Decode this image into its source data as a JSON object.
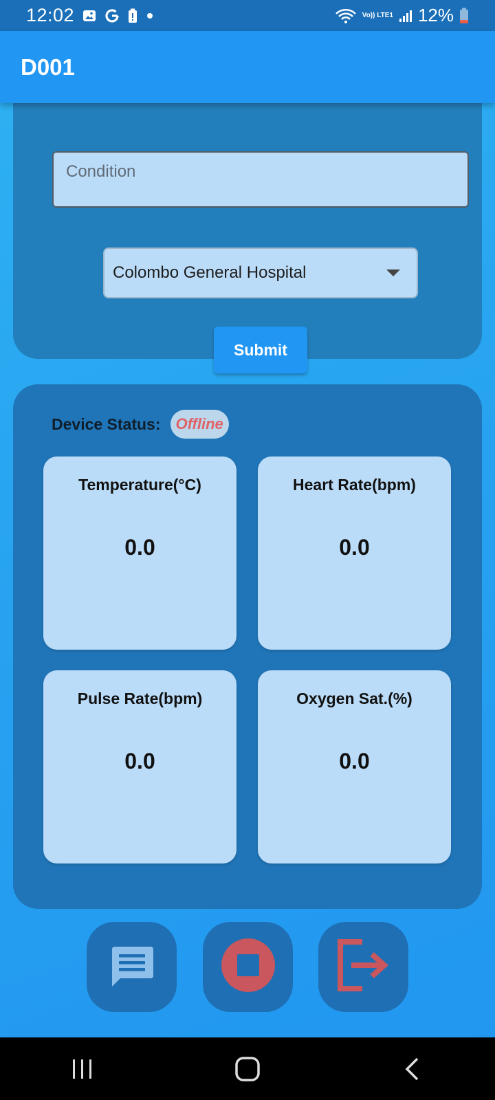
{
  "status_bar": {
    "time": "12:02",
    "battery": "12%",
    "network_label": "Vo)) LTE1"
  },
  "app_bar": {
    "title": "D001"
  },
  "form": {
    "condition_placeholder": "Condition",
    "hospital_selected": "Colombo General Hospital",
    "submit_label": "Submit"
  },
  "device": {
    "status_label": "Device Status:",
    "status_value": "Offline",
    "metrics": [
      {
        "label": "Temperature(°C)",
        "value": "0.0"
      },
      {
        "label": "Heart Rate(bpm)",
        "value": "0.0"
      },
      {
        "label": "Pulse Rate(bpm)",
        "value": "0.0"
      },
      {
        "label": "Oxygen Sat.(%)",
        "value": "0.0"
      }
    ]
  },
  "actions": [
    {
      "icon": "message-icon"
    },
    {
      "icon": "stop-icon"
    },
    {
      "icon": "logout-icon"
    }
  ],
  "colors": {
    "primary": "#2196f3",
    "card_dark": "#2075b8",
    "card_light": "#bbdcf8",
    "offline_red": "#e06366",
    "icon_red": "#c9575d"
  }
}
